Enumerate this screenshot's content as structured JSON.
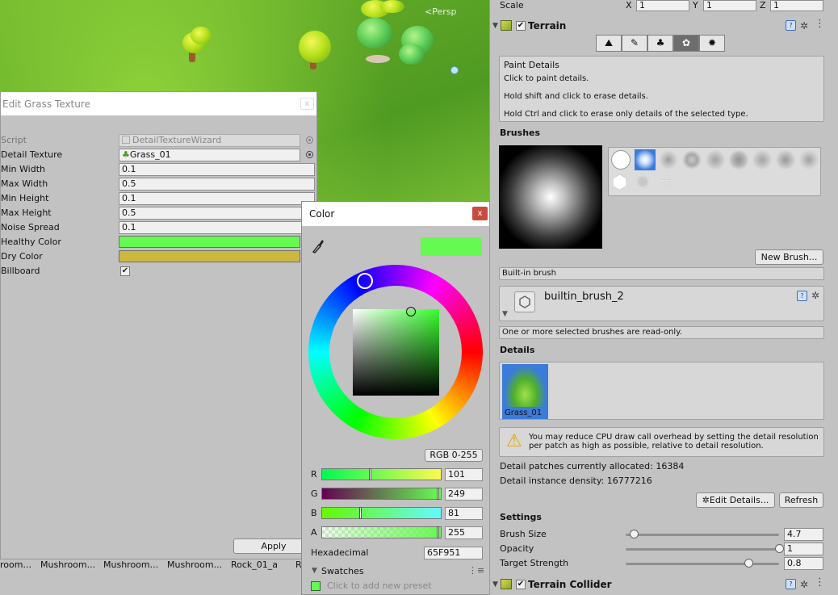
{
  "scene": {
    "view_label": "<Persp"
  },
  "project_bar": {
    "items": [
      "room...",
      "Mushroom...",
      "Mushroom...",
      "Mushroom...",
      "Rock_01_a",
      "R"
    ]
  },
  "wizard": {
    "title": "Edit Grass Texture",
    "close_label": "x",
    "rows": {
      "script": {
        "label": "Script",
        "value": "DetailTextureWizard"
      },
      "detail_texture": {
        "label": "Detail Texture",
        "value": "Grass_01"
      },
      "min_width": {
        "label": "Min Width",
        "value": "0.1"
      },
      "max_width": {
        "label": "Max Width",
        "value": "0.5"
      },
      "min_height": {
        "label": "Min Height",
        "value": "0.1"
      },
      "max_height": {
        "label": "Max Height",
        "value": "0.5"
      },
      "noise_spread": {
        "label": "Noise Spread",
        "value": "0.1"
      },
      "healthy_color": {
        "label": "Healthy Color",
        "color": "#65F951"
      },
      "dry_color": {
        "label": "Dry Color",
        "color": "#CDB83E"
      },
      "billboard": {
        "label": "Billboard",
        "checked": "✔"
      }
    },
    "apply_label": "Apply"
  },
  "color_picker": {
    "title": "Color",
    "close_label": "x",
    "preview_color": "#65F951",
    "mode_label": "RGB 0-255",
    "channels": {
      "r": {
        "label": "R",
        "value": "101"
      },
      "g": {
        "label": "G",
        "value": "249"
      },
      "b": {
        "label": "B",
        "value": "81"
      },
      "a": {
        "label": "A",
        "value": "255"
      }
    },
    "hex_label": "Hexadecimal",
    "hex_value": "65F951",
    "swatches_label": "Swatches",
    "add_preset_label": "Click to add new preset"
  },
  "inspector": {
    "scale": {
      "label": "Scale",
      "x_label": "X",
      "x": "1",
      "y_label": "Y",
      "y": "1",
      "z_label": "Z",
      "z": "1"
    },
    "terrain": {
      "title": "Terrain",
      "enabled": "✔",
      "tools": [
        "raise-lower-icon",
        "paint-texture-icon",
        "place-trees-icon",
        "paint-details-icon",
        "settings-icon"
      ],
      "help_title": "Paint Details",
      "help_lines": [
        "Click to paint details.",
        "Hold shift and click to erase details.",
        "Hold Ctrl and click to erase only details of the selected type."
      ]
    },
    "brushes": {
      "heading": "Brushes",
      "new_brush_label": "New Brush...",
      "builtin_label": "Built-in brush",
      "brush_name": "builtin_brush_2",
      "readonly_note": "One or more selected brushes are read-only."
    },
    "details": {
      "heading": "Details",
      "item_label": "Grass_01",
      "warning": "You may reduce CPU draw call overhead by setting the detail resolution per patch as high as possible, relative to detail resolution.",
      "patches_text": "Detail patches currently allocated: 16384",
      "density_text": "Detail instance density: 16777216",
      "edit_label": "Edit Details...",
      "refresh_label": "Refresh"
    },
    "settings": {
      "heading": "Settings",
      "brush_size": {
        "label": "Brush Size",
        "value": "4.7",
        "fraction": 0.05
      },
      "opacity": {
        "label": "Opacity",
        "value": "1",
        "fraction": 1.0
      },
      "target_strength": {
        "label": "Target Strength",
        "value": "0.8",
        "fraction": 0.8
      }
    },
    "collider": {
      "title": "Terrain Collider",
      "enabled": "✔"
    }
  }
}
